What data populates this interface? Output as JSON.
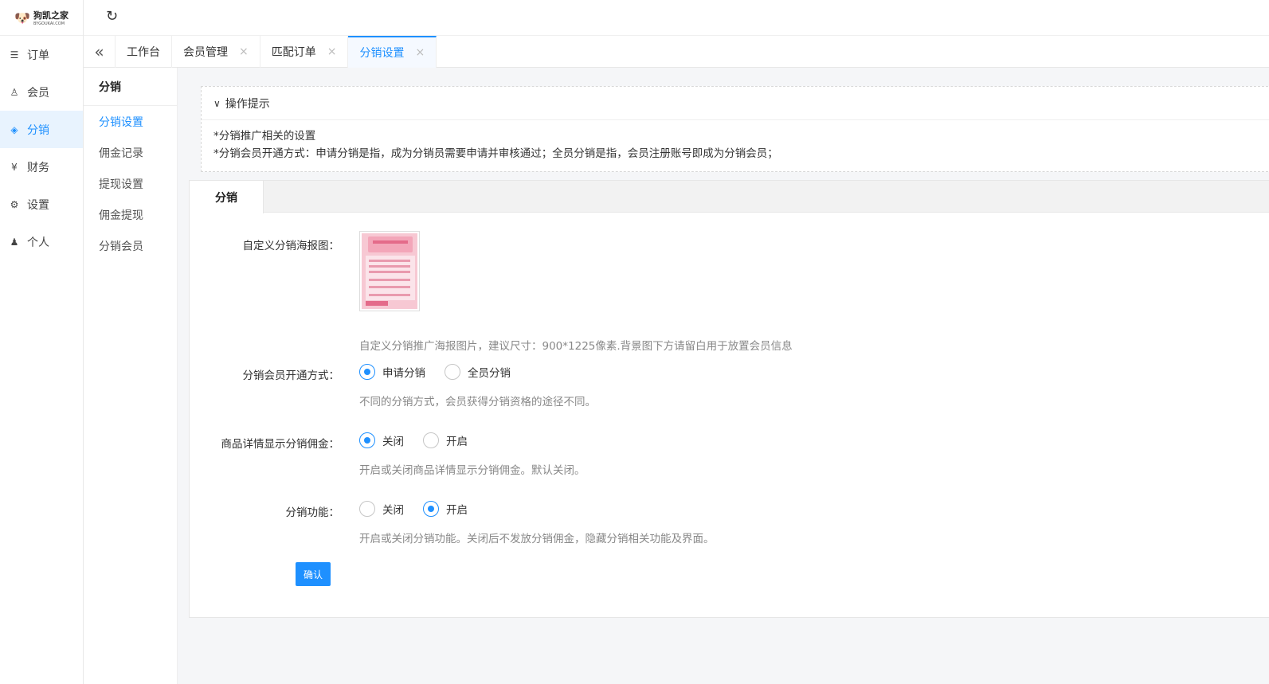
{
  "logo": {
    "text": "狗凯之家",
    "sub": "BYGOUKAI.COM",
    "icon": "dog-logo-icon"
  },
  "sidebar": {
    "items": [
      {
        "label": "订单",
        "icon": "list-icon",
        "active": false
      },
      {
        "label": "会员",
        "icon": "user-icon",
        "active": false
      },
      {
        "label": "分销",
        "icon": "layers-icon",
        "active": true
      },
      {
        "label": "财务",
        "icon": "yen-icon",
        "active": false
      },
      {
        "label": "设置",
        "icon": "gear-icon",
        "active": false
      },
      {
        "label": "个人",
        "icon": "person-icon",
        "active": false
      }
    ]
  },
  "topbar": {
    "refresh_icon": "refresh-icon"
  },
  "tabs": [
    {
      "label": "工作台",
      "closable": false,
      "active": false
    },
    {
      "label": "会员管理",
      "closable": true,
      "active": false
    },
    {
      "label": "匹配订单",
      "closable": true,
      "active": false
    },
    {
      "label": "分销设置",
      "closable": true,
      "active": true
    }
  ],
  "subnav": {
    "title": "分销",
    "items": [
      {
        "label": "分销设置",
        "active": true
      },
      {
        "label": "佣金记录",
        "active": false
      },
      {
        "label": "提现设置",
        "active": false
      },
      {
        "label": "佣金提现",
        "active": false
      },
      {
        "label": "分销会员",
        "active": false
      }
    ]
  },
  "tips": {
    "title": "操作提示",
    "lines": [
      "*分销推广相关的设置",
      "*分销会员开通方式：申请分销是指，成为分销员需要申请并审核通过；全员分销是指，会员注册账号即成为分销会员；"
    ]
  },
  "form": {
    "tab_label": "分销",
    "poster": {
      "label": "自定义分销海报图：",
      "hint": "自定义分销推广海报图片，建议尺寸：900*1225像素.背景图下方请留白用于放置会员信息"
    },
    "open_mode": {
      "label": "分销会员开通方式：",
      "options": [
        "申请分销",
        "全员分销"
      ],
      "selected": "申请分销",
      "hint": "不同的分销方式，会员获得分销资格的途径不同。"
    },
    "show_commission": {
      "label": "商品详情显示分销佣金：",
      "options": [
        "关闭",
        "开启"
      ],
      "selected": "关闭",
      "hint": "开启或关闭商品详情显示分销佣金。默认关闭。"
    },
    "enabled": {
      "label": "分销功能：",
      "options": [
        "关闭",
        "开启"
      ],
      "selected": "开启",
      "hint": "开启或关闭分销功能。关闭后不发放分销佣金，隐藏分销相关功能及界面。"
    },
    "confirm_label": "确认"
  },
  "colors": {
    "accent": "#1e90ff",
    "active_bg": "#e8f3fe"
  }
}
